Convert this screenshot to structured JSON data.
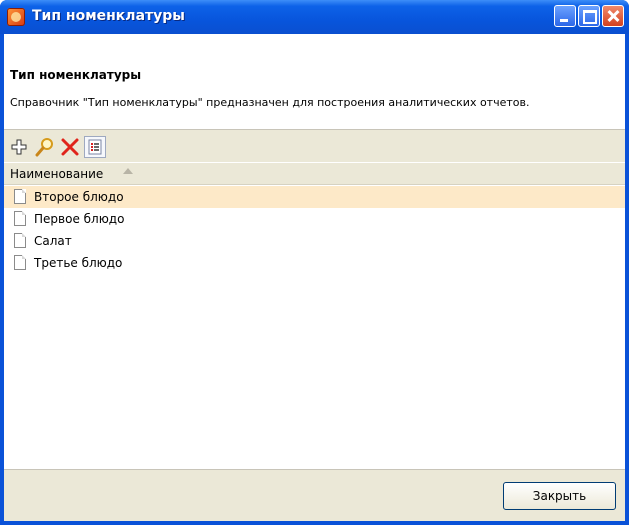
{
  "window": {
    "title": "Тип номенклатуры",
    "accent": "#0a52d8"
  },
  "header": {
    "title": "Тип номенклатуры",
    "description": "Справочник \"Тип номенклатуры\" предназначен для построения аналитических отчетов."
  },
  "toolbar": {
    "tools": [
      "add-icon",
      "find-icon",
      "delete-icon",
      "list-view-icon"
    ]
  },
  "table": {
    "column_header": "Наименование",
    "sort": "ascending",
    "rows": [
      {
        "label": "Второе блюдо",
        "selected": true
      },
      {
        "label": "Первое блюдо",
        "selected": false
      },
      {
        "label": "Салат",
        "selected": false
      },
      {
        "label": "Третье блюдо",
        "selected": false
      }
    ]
  },
  "footer": {
    "close_label": "Закрыть"
  }
}
